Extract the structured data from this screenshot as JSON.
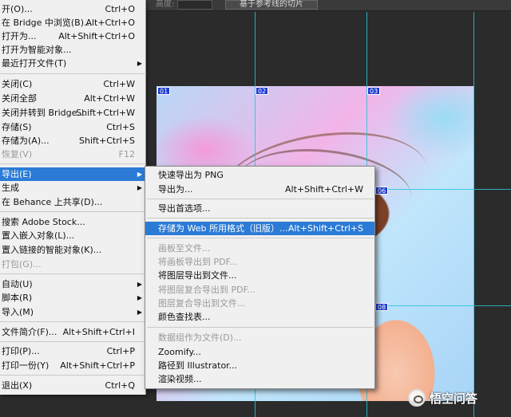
{
  "options_bar": {
    "height_label": "高度:",
    "slice_button": "基于参考线的切片"
  },
  "canvas": {
    "slice_tags": [
      "01",
      "02",
      "03",
      "06",
      "08"
    ]
  },
  "file_menu": {
    "items": [
      {
        "label": "开(O)...",
        "shortcut": "Ctrl+O"
      },
      {
        "label": "在 Bridge 中浏览(B)...",
        "shortcut": "Alt+Ctrl+O"
      },
      {
        "label": "打开为...",
        "shortcut": "Alt+Shift+Ctrl+O"
      },
      {
        "label": "打开为智能对象...",
        "shortcut": ""
      },
      {
        "label": "最近打开文件(T)",
        "shortcut": ""
      },
      {
        "label": "关闭(C)",
        "shortcut": "Ctrl+W"
      },
      {
        "label": "关闭全部",
        "shortcut": "Alt+Ctrl+W"
      },
      {
        "label": "关闭并转到 Bridge...",
        "shortcut": "Shift+Ctrl+W"
      },
      {
        "label": "存储(S)",
        "shortcut": "Ctrl+S"
      },
      {
        "label": "存储为(A)...",
        "shortcut": "Shift+Ctrl+S"
      },
      {
        "label": "恢复(V)",
        "shortcut": "F12"
      },
      {
        "label": "导出(E)",
        "shortcut": ""
      },
      {
        "label": "生成",
        "shortcut": ""
      },
      {
        "label": "在 Behance 上共享(D)...",
        "shortcut": ""
      },
      {
        "label": "搜索 Adobe Stock...",
        "shortcut": ""
      },
      {
        "label": "置入嵌入对象(L)...",
        "shortcut": ""
      },
      {
        "label": "置入链接的智能对象(K)...",
        "shortcut": ""
      },
      {
        "label": "打包(G)...",
        "shortcut": ""
      },
      {
        "label": "自动(U)",
        "shortcut": ""
      },
      {
        "label": "脚本(R)",
        "shortcut": ""
      },
      {
        "label": "导入(M)",
        "shortcut": ""
      },
      {
        "label": "文件简介(F)...",
        "shortcut": "Alt+Shift+Ctrl+I"
      },
      {
        "label": "打印(P)...",
        "shortcut": "Ctrl+P"
      },
      {
        "label": "打印一份(Y)",
        "shortcut": "Alt+Shift+Ctrl+P"
      },
      {
        "label": "退出(X)",
        "shortcut": "Ctrl+Q"
      }
    ]
  },
  "export_menu": {
    "items": [
      {
        "label": "快速导出为 PNG",
        "shortcut": ""
      },
      {
        "label": "导出为...",
        "shortcut": "Alt+Shift+Ctrl+W"
      },
      {
        "label": "导出首选项...",
        "shortcut": ""
      },
      {
        "label": "存储为 Web 所用格式（旧版）...",
        "shortcut": "Alt+Shift+Ctrl+S"
      },
      {
        "label": "画板至文件...",
        "shortcut": ""
      },
      {
        "label": "将画板导出到 PDF...",
        "shortcut": ""
      },
      {
        "label": "将图层导出到文件...",
        "shortcut": ""
      },
      {
        "label": "将图层复合导出到 PDF...",
        "shortcut": ""
      },
      {
        "label": "图层复合导出到文件...",
        "shortcut": ""
      },
      {
        "label": "颜色查找表...",
        "shortcut": ""
      },
      {
        "label": "数据组作为文件(D)...",
        "shortcut": ""
      },
      {
        "label": "Zoomify...",
        "shortcut": ""
      },
      {
        "label": "路径到 Illustrator...",
        "shortcut": ""
      },
      {
        "label": "渲染视频...",
        "shortcut": ""
      }
    ]
  },
  "watermark": {
    "text": "悟空问答"
  },
  "colors": {
    "highlight": "#2b7bd6",
    "guide": "#27c4d8",
    "slice_tag": "#1d3bd1"
  }
}
